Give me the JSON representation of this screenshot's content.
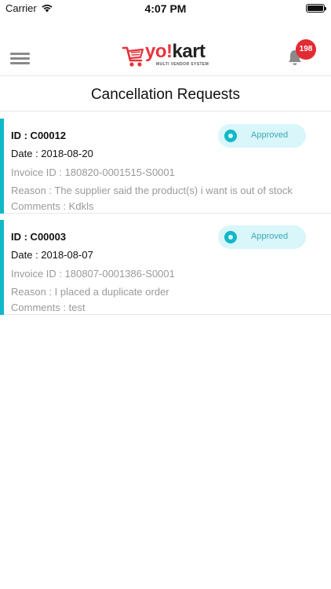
{
  "status_bar": {
    "carrier": "Carrier",
    "time": "4:07 PM"
  },
  "header": {
    "logo_text_yo": "yo!",
    "logo_text_kart": "kart",
    "logo_tagline": "MULTI VENDOR SYSTEM",
    "notification_count": "198"
  },
  "page": {
    "title": "Cancellation Requests"
  },
  "colors": {
    "accent": "#11b8c8",
    "badge": "#e22b32",
    "brand_red": "#e8333c"
  },
  "requests": [
    {
      "id": "ID : C00012",
      "date": "Date : 2018-08-20",
      "invoice": "Invoice ID : 180820-0001515-S0001",
      "reason": "Reason : The supplier said the product(s) i want is out of stock",
      "comments": "Comments : Kdkls",
      "status": "Approved"
    },
    {
      "id": "ID : C00003",
      "date": "Date : 2018-08-07",
      "invoice": "Invoice ID : 180807-0001386-S0001",
      "reason": "Reason : I placed a duplicate order",
      "comments": "Comments : test",
      "status": "Approved"
    }
  ]
}
